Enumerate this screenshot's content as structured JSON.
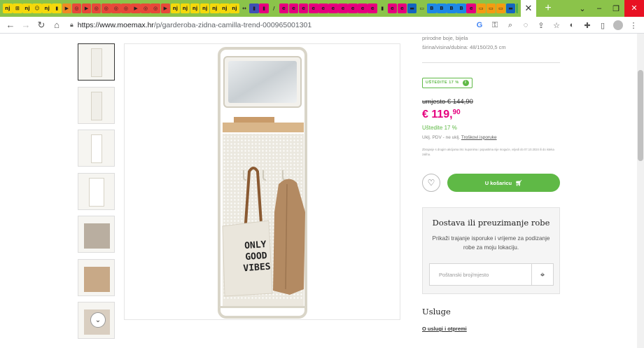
{
  "browser": {
    "tabs": [
      {
        "label": "nj",
        "color": "#f5d90a"
      },
      {
        "label": "⊞",
        "color": "#f5d90a"
      },
      {
        "label": "nj",
        "color": "#f5d90a"
      },
      {
        "label": "☺",
        "color": "#f5d90a"
      },
      {
        "label": "nj",
        "color": "#f5d90a"
      },
      {
        "label": "▮",
        "color": "#f5d90a"
      },
      {
        "label": "▶",
        "color": "#f08a24"
      },
      {
        "label": "◎",
        "color": "#e8483a"
      },
      {
        "label": "▶",
        "color": "#e8483a"
      },
      {
        "label": "◎",
        "color": "#e8483a"
      },
      {
        "label": "◎",
        "color": "#e8483a"
      },
      {
        "label": "◎",
        "color": "#e8483a"
      },
      {
        "label": "◎",
        "color": "#e8483a"
      },
      {
        "label": "▶",
        "color": "#e8483a"
      },
      {
        "label": "◎",
        "color": "#e8483a"
      },
      {
        "label": "◎",
        "color": "#e8483a"
      },
      {
        "label": "▶",
        "color": "#e8483a"
      },
      {
        "label": "nj",
        "color": "#f5d90a"
      },
      {
        "label": "nj",
        "color": "#f5d90a"
      },
      {
        "label": "nj",
        "color": "#f5d90a"
      },
      {
        "label": "nj",
        "color": "#f5d90a"
      },
      {
        "label": "nj",
        "color": "#f5d90a"
      },
      {
        "label": "nj",
        "color": "#f5d90a"
      },
      {
        "label": "nj",
        "color": "#f5d90a"
      },
      {
        "label": "↔",
        "color": "#8bc34a"
      },
      {
        "label": "▮",
        "color": "#3f51b5"
      },
      {
        "label": "▮",
        "color": "#e5007e"
      },
      {
        "label": "/",
        "color": "#8bc34a"
      },
      {
        "label": "e",
        "color": "#e5007e"
      },
      {
        "label": "e",
        "color": "#e5007e"
      },
      {
        "label": "e",
        "color": "#e5007e"
      },
      {
        "label": "e",
        "color": "#e5007e"
      },
      {
        "label": "e",
        "color": "#e5007e"
      },
      {
        "label": "e",
        "color": "#e5007e"
      },
      {
        "label": "e",
        "color": "#e5007e"
      },
      {
        "label": "e",
        "color": "#e5007e"
      },
      {
        "label": "e",
        "color": "#e5007e"
      },
      {
        "label": "e",
        "color": "#e5007e"
      },
      {
        "label": "▮",
        "color": "#8bc34a"
      },
      {
        "label": "e",
        "color": "#e5007e"
      },
      {
        "label": "e",
        "color": "#e5007e"
      },
      {
        "label": "▬",
        "color": "#1565c0"
      },
      {
        "label": "▭",
        "color": "#8bc34a"
      },
      {
        "label": "B",
        "color": "#1e88e5"
      },
      {
        "label": "B",
        "color": "#1e88e5"
      },
      {
        "label": "B",
        "color": "#1e88e5"
      },
      {
        "label": "B",
        "color": "#1e88e5"
      },
      {
        "label": "e",
        "color": "#e5007e"
      },
      {
        "label": "▭",
        "color": "#f39c12"
      },
      {
        "label": "▭",
        "color": "#f39c12"
      },
      {
        "label": "▭",
        "color": "#f39c12"
      },
      {
        "label": "▬",
        "color": "#1565c0"
      },
      {
        "label": "◎",
        "color": "#4caf50"
      },
      {
        "label": "◎",
        "color": "#4caf50"
      },
      {
        "label": "nj",
        "color": "#f5d90a"
      }
    ],
    "active_tab_close": "✕",
    "new_tab": "+",
    "window_controls": [
      "⌄",
      "–",
      "❐",
      "✕"
    ],
    "url_host": "https://www.moemax.hr",
    "url_path": "/p/garderoba-zidna-camilla-trend-000965001301"
  },
  "gallery": {
    "scroll_down_icon": "⌄"
  },
  "product": {
    "spec_line1": "prirodne boje, bijela",
    "spec_line2": "širina/visina/dubina: 48/150/20,5 cm",
    "badge": "UŠTEDITE 17 %",
    "old_price": "umjesto € 144,90",
    "price_main": "€ 119,",
    "price_cents": "90",
    "savings": "Uštedite 17 %",
    "vat_text": "Uklj. PDV - ne uklj.",
    "shipping_link": "Troškovi isporuke",
    "fine_print": "Zbrajanje s drugim akcijama itsr. kuponima i popustima nije moguće, vrijedi do 07.10.2024 ili do isteka zaliha.",
    "cart_button": "U košaricu"
  },
  "delivery": {
    "title": "Dostava ili preuzimanje robe",
    "text": "Prikaži trajanje isporuke i vrijeme za podizanje robe za moju lokaciju.",
    "zip_placeholder": "Poštanski broj/mjesto"
  },
  "services": {
    "title": "Usluge",
    "link": "O uslugi i otpremi"
  },
  "image_text": {
    "bag_line1": "ONLY",
    "bag_line2": "GOOD",
    "bag_line3": "VIBES"
  }
}
